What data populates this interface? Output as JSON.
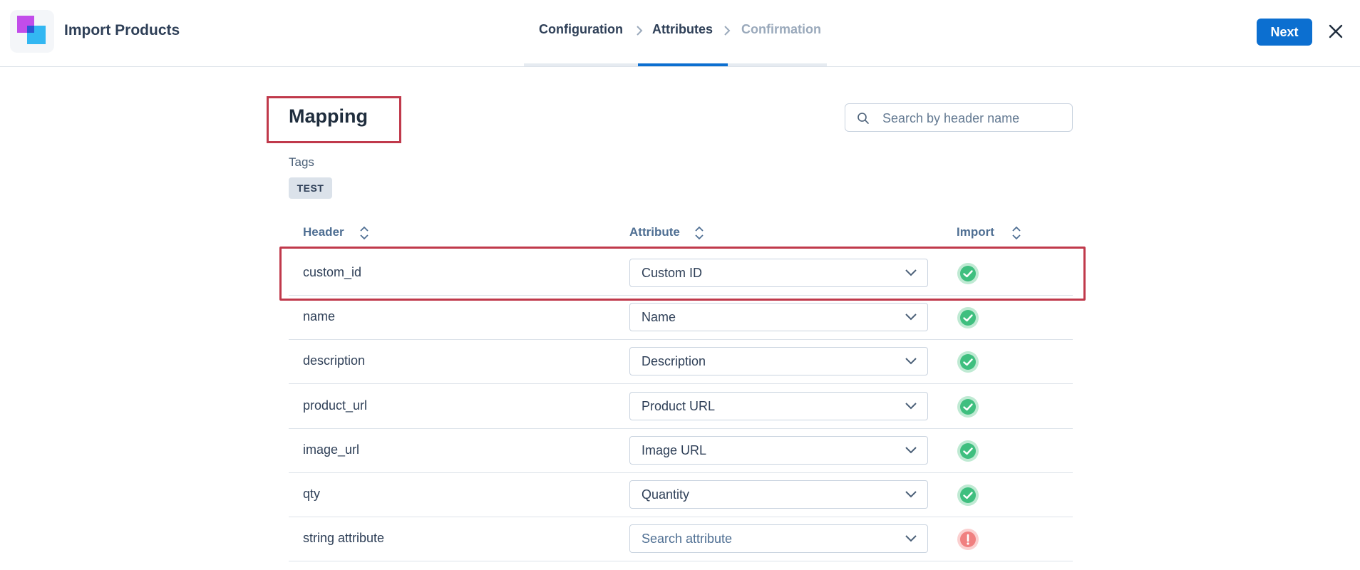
{
  "app": {
    "title": "Import Products"
  },
  "steps": [
    {
      "label": "Configuration",
      "state": "done"
    },
    {
      "label": "Attributes",
      "state": "active"
    },
    {
      "label": "Confirmation",
      "state": "pending"
    }
  ],
  "toolbar": {
    "next_label": "Next"
  },
  "main": {
    "title": "Mapping",
    "search_placeholder": "Search by header name",
    "tags_label": "Tags",
    "tags": [
      "TEST"
    ]
  },
  "table": {
    "columns": [
      "Header",
      "Attribute",
      "Import"
    ],
    "rows": [
      {
        "header": "custom_id",
        "attribute": "Custom ID",
        "placeholder": false,
        "status": "ok"
      },
      {
        "header": "name",
        "attribute": "Name",
        "placeholder": false,
        "status": "ok"
      },
      {
        "header": "description",
        "attribute": "Description",
        "placeholder": false,
        "status": "ok"
      },
      {
        "header": "product_url",
        "attribute": "Product URL",
        "placeholder": false,
        "status": "ok"
      },
      {
        "header": "image_url",
        "attribute": "Image URL",
        "placeholder": false,
        "status": "ok"
      },
      {
        "header": "qty",
        "attribute": "Quantity",
        "placeholder": false,
        "status": "ok"
      },
      {
        "header": "string attribute",
        "attribute": "Search attribute",
        "placeholder": true,
        "status": "error"
      }
    ]
  },
  "colors": {
    "accent": "#0c6fd0",
    "highlight": "#c0394b",
    "success": "#3fbf7f",
    "error": "#f08080"
  }
}
